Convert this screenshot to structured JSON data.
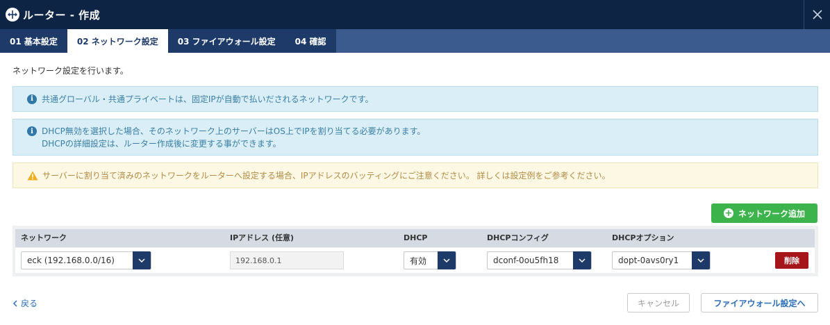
{
  "header": {
    "title": "ルーター - 作成",
    "logo_icon": "router-icon",
    "close_icon": "close-icon"
  },
  "tabs": [
    {
      "label": "01 基本設定",
      "active": false
    },
    {
      "label": "02 ネットワーク設定",
      "active": true
    },
    {
      "label": "03 ファイアウォール設定",
      "active": false
    },
    {
      "label": "04 確認",
      "active": false
    }
  ],
  "intro": "ネットワーク設定を行います。",
  "alerts": {
    "info1": "共通グローバル・共通プライベートは、固定IPが自動で払いだされるネットワークです。",
    "info2_line1": "DHCP無効を選択した場合、そのネットワーク上のサーバーはOS上でIPを割り当てる必要があります。",
    "info2_line2": "DHCPの詳細設定は、ルーター作成後に変更する事ができます。",
    "warning": "サーバーに割り当て済みのネットワークをルーターへ設定する場合、IPアドレスのバッティングにご注意ください。 詳しくは設定例をご参考ください。"
  },
  "add_network_label": "ネットワーク追加",
  "table": {
    "headers": {
      "network": "ネットワーク",
      "ip": "IPアドレス (任意)",
      "dhcp": "DHCP",
      "dhcp_config": "DHCPコンフィグ",
      "dhcp_option": "DHCPオプション"
    },
    "row": {
      "network": "eck (192.168.0.0/16)",
      "ip": "192.168.0.1",
      "dhcp": "有効",
      "dhcp_config": "dconf-0ou5fh18",
      "dhcp_option": "dopt-0avs0ry1",
      "delete_label": "削除"
    }
  },
  "footer": {
    "back_label": "戻る",
    "cancel_label": "キャンセル",
    "next_label": "ファイアウォール設定へ"
  },
  "colors": {
    "header_bg": "#0d2445",
    "tab_bg": "#1d3a69",
    "primary_green": "#3cb44b",
    "danger_red": "#a4161a",
    "info_bg": "#d9eef6",
    "warning_bg": "#fcf8e4"
  }
}
